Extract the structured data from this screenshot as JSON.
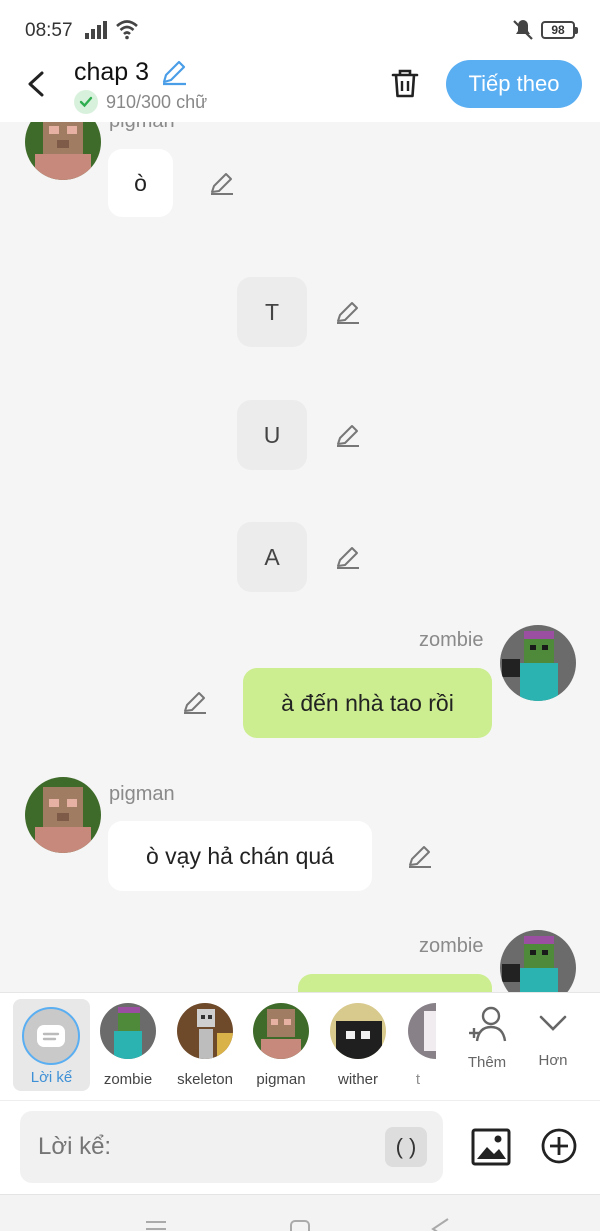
{
  "status_bar": {
    "time": "08:57",
    "battery": "98"
  },
  "header": {
    "title": "chap 3",
    "word_count": "910/300 chữ",
    "next_label": "Tiếp theo"
  },
  "messages": [
    {
      "speaker": "pigman",
      "text": "ò"
    },
    {
      "speaker": "",
      "text": "T"
    },
    {
      "speaker": "",
      "text": "U"
    },
    {
      "speaker": "",
      "text": "A"
    },
    {
      "speaker": "zombie",
      "text": "à đến nhà tao rồi"
    },
    {
      "speaker": "pigman",
      "text": "ò vạy hả chán quá"
    },
    {
      "speaker": "zombie",
      "text": ""
    }
  ],
  "partial_name_top": "pigman",
  "characters": [
    {
      "label": "Lời kể",
      "selected": true
    },
    {
      "label": "zombie"
    },
    {
      "label": "skeleton"
    },
    {
      "label": "pigman"
    },
    {
      "label": "wither"
    },
    {
      "label": "t"
    }
  ],
  "toolbar": {
    "add_label": "Thêm",
    "more_label": "Hơn"
  },
  "input": {
    "placeholder": "Lời kể:",
    "paren": "( )"
  },
  "colors": {
    "accent": "#5aaef2",
    "green_bubble": "#ccee90"
  }
}
